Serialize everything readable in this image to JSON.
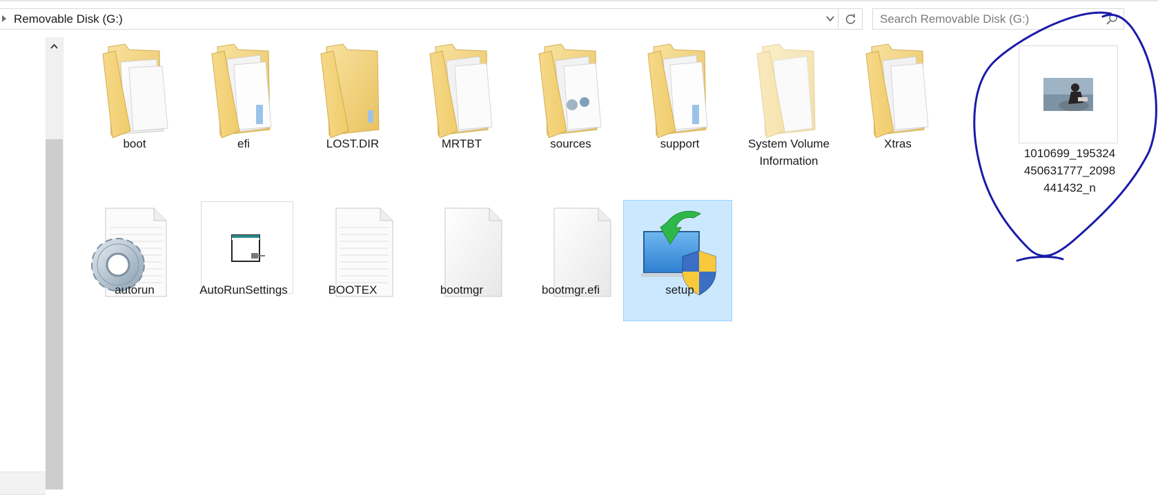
{
  "address": {
    "path": "Removable Disk (G:)"
  },
  "search": {
    "placeholder": "Search Removable Disk (G:)"
  },
  "folders": [
    {
      "name": "boot"
    },
    {
      "name": "efi"
    },
    {
      "name": "LOST.DIR"
    },
    {
      "name": "MRTBT"
    },
    {
      "name": "sources"
    },
    {
      "name": "support"
    },
    {
      "name": "System Volume Information"
    },
    {
      "name": "Xtras"
    }
  ],
  "image_file": {
    "name_line1": "1010699_195324",
    "name_line2": "450631777_2098",
    "name_line3": "441432_n"
  },
  "files": [
    {
      "name": "autorun"
    },
    {
      "name": "AutoRunSettings"
    },
    {
      "name": "BOOTEX"
    },
    {
      "name": "bootmgr"
    },
    {
      "name": "bootmgr.efi"
    },
    {
      "name": "setup"
    }
  ],
  "colors": {
    "selection_fill": "#cce8ff",
    "selection_border": "#99d1ff",
    "annotation_ink": "#1a1aa8",
    "folder_yellow": "#f3d57a"
  },
  "icons": {
    "folder": "folder-icon",
    "settings_file": "gear-document-icon",
    "shortcut": "window-shortcut-icon",
    "text_file": "text-document-icon",
    "blank_file": "blank-document-icon",
    "installer": "setup-shield-icon",
    "image": "photo-thumbnail-icon"
  }
}
